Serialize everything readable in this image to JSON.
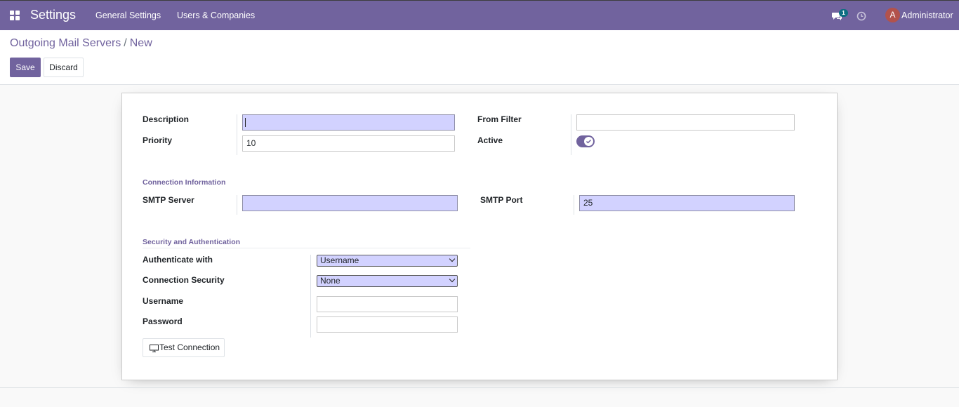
{
  "navbar": {
    "app_title": "Settings",
    "menu": [
      "General Settings",
      "Users & Companies"
    ],
    "chat_badge": "1",
    "avatar_letter": "A",
    "user_name": "Administrator"
  },
  "breadcrumb": {
    "parent": "Outgoing Mail Servers",
    "separator": "/",
    "current": "New"
  },
  "actions": {
    "save": "Save",
    "discard": "Discard"
  },
  "form": {
    "description_label": "Description",
    "description_value": "",
    "priority_label": "Priority",
    "priority_value": "10",
    "from_filter_label": "From Filter",
    "from_filter_value": "",
    "active_label": "Active",
    "active_checked": true,
    "connection_section": "Connection Information",
    "smtp_server_label": "SMTP Server",
    "smtp_server_value": "",
    "smtp_port_label": "SMTP Port",
    "smtp_port_value": "25",
    "security_section": "Security and Authentication",
    "auth_label": "Authenticate with",
    "auth_value": "Username",
    "conn_security_label": "Connection Security",
    "conn_security_value": "None",
    "username_label": "Username",
    "username_value": "",
    "password_label": "Password",
    "password_value": "",
    "test_connection": "Test Connection"
  },
  "colors": {
    "brand": "#71639e",
    "required_field": "#d2d2ff",
    "avatar": "#b2524c",
    "badge": "#0d6e82"
  }
}
